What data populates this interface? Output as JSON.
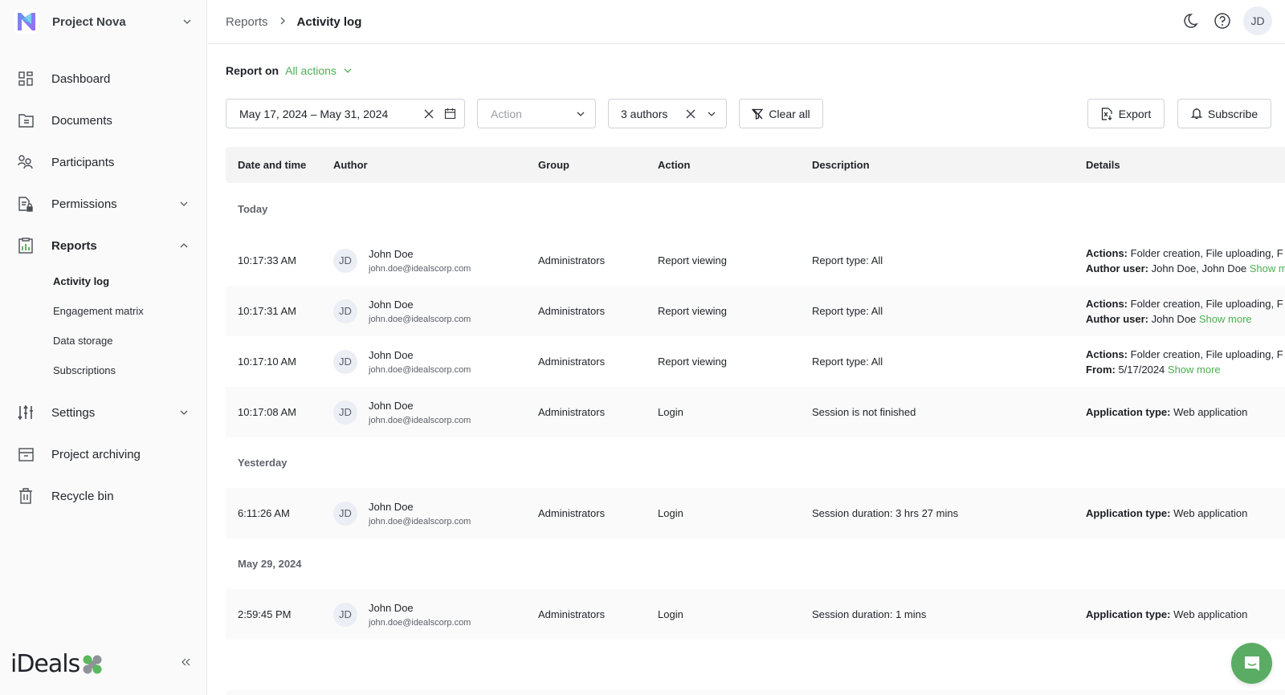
{
  "sidebar": {
    "project_name": "Project Nova",
    "items": [
      {
        "label": "Dashboard",
        "icon": "dashboard-icon"
      },
      {
        "label": "Documents",
        "icon": "folder-icon"
      },
      {
        "label": "Participants",
        "icon": "participants-icon"
      },
      {
        "label": "Permissions",
        "icon": "permissions-lock-icon"
      },
      {
        "label": "Reports",
        "icon": "reports-icon"
      },
      {
        "label": "Settings",
        "icon": "sliders-icon"
      },
      {
        "label": "Project archiving",
        "icon": "archive-icon"
      },
      {
        "label": "Recycle bin",
        "icon": "trash-icon"
      }
    ],
    "reports_subitems": [
      {
        "label": "Activity log",
        "active": true
      },
      {
        "label": "Engagement matrix",
        "active": false
      },
      {
        "label": "Data storage",
        "active": false
      },
      {
        "label": "Subscriptions",
        "active": false
      }
    ],
    "brand": "iDeals",
    "brand_colors": {
      "green": "#5cb85c",
      "gray": "#8e9399"
    }
  },
  "topbar": {
    "breadcrumb": [
      "Reports",
      "Activity log"
    ],
    "avatar_initials": "JD"
  },
  "report_on": {
    "label": "Report on",
    "value": "All actions"
  },
  "filters": {
    "date_range": "May 17, 2024 – May 31, 2024",
    "action_placeholder": "Action",
    "authors": "3 authors",
    "clear_all": "Clear all",
    "export": "Export",
    "subscribe": "Subscribe"
  },
  "table": {
    "columns": [
      "Date and time",
      "Author",
      "Group",
      "Action",
      "Description",
      "Details"
    ],
    "groups": [
      {
        "label": "Today",
        "rows": [
          {
            "time": "10:17:33 AM",
            "initials": "JD",
            "name": "John Doe",
            "email": "john.doe@idealscorp.com",
            "group": "Administrators",
            "action": "Report viewing",
            "description": "Report type: All",
            "details": [
              {
                "key": "Actions",
                "value": " Folder creation, File uploading, F",
                "more": ""
              },
              {
                "key": "Author user",
                "value": " John Doe, John Doe ",
                "more": "Show more"
              }
            ]
          },
          {
            "time": "10:17:31 AM",
            "initials": "JD",
            "name": "John Doe",
            "email": "john.doe@idealscorp.com",
            "group": "Administrators",
            "action": "Report viewing",
            "description": "Report type: All",
            "details": [
              {
                "key": "Actions",
                "value": " Folder creation, File uploading, F",
                "more": ""
              },
              {
                "key": "Author user",
                "value": " John Doe ",
                "more": "Show more"
              }
            ]
          },
          {
            "time": "10:17:10 AM",
            "initials": "JD",
            "name": "John Doe",
            "email": "john.doe@idealscorp.com",
            "group": "Administrators",
            "action": "Report viewing",
            "description": "Report type: All",
            "details": [
              {
                "key": "Actions",
                "value": " Folder creation, File uploading, F",
                "more": ""
              },
              {
                "key": "From",
                "value": " 5/17/2024 ",
                "more": "Show more"
              }
            ]
          },
          {
            "time": "10:17:08 AM",
            "initials": "JD",
            "name": "John Doe",
            "email": "john.doe@idealscorp.com",
            "group": "Administrators",
            "action": "Login",
            "description": "Session is not finished",
            "details": [
              {
                "key": "Application type",
                "value": " Web application",
                "more": ""
              }
            ]
          }
        ]
      },
      {
        "label": "Yesterday",
        "rows": [
          {
            "time": "6:11:26 AM",
            "initials": "JD",
            "name": "John Doe",
            "email": "john.doe@idealscorp.com",
            "group": "Administrators",
            "action": "Login",
            "description": "Session duration: 3 hrs 27 mins",
            "details": [
              {
                "key": "Application type",
                "value": " Web application",
                "more": ""
              }
            ]
          }
        ]
      },
      {
        "label": "May 29, 2024",
        "rows": [
          {
            "time": "2:59:45 PM",
            "initials": "JD",
            "name": "John Doe",
            "email": "john.doe@idealscorp.com",
            "group": "Administrators",
            "action": "Login",
            "description": "Session duration: 1 mins",
            "details": [
              {
                "key": "Application type",
                "value": " Web application",
                "more": ""
              }
            ]
          }
        ]
      }
    ]
  },
  "colors": {
    "accent_green": "#4caf50",
    "chat_button": "#5aac64"
  }
}
